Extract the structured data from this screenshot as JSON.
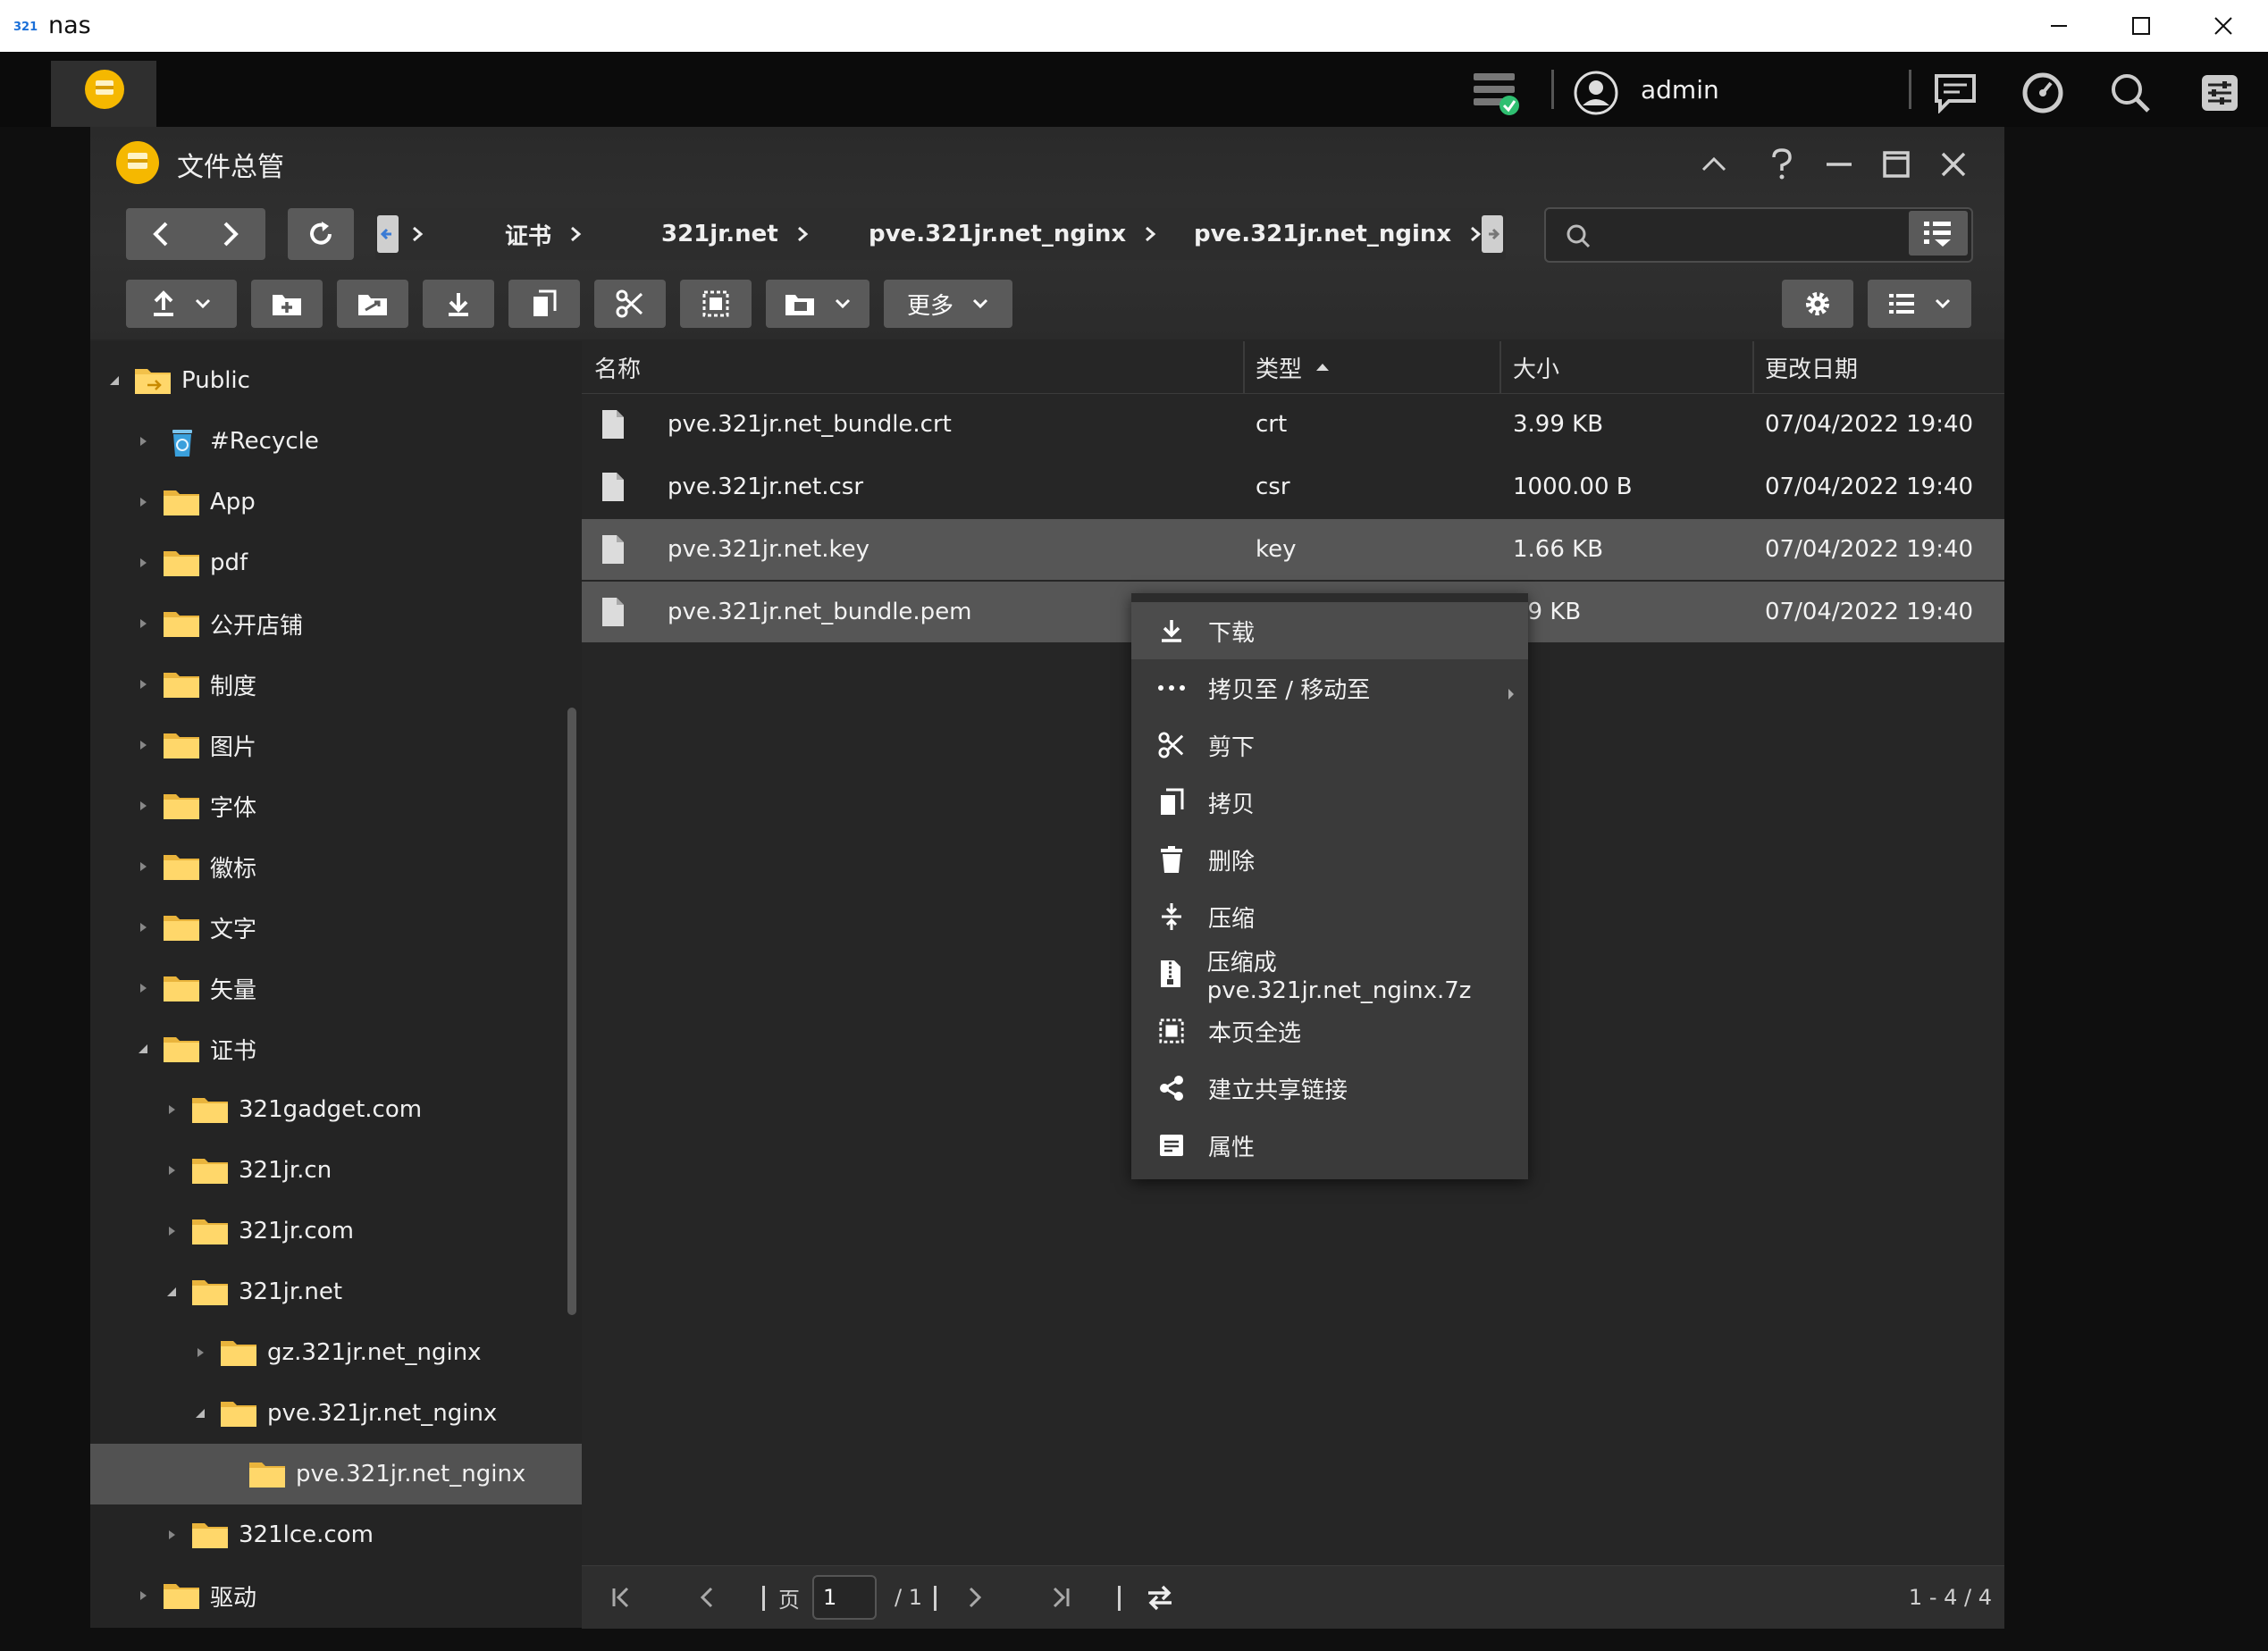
{
  "os_window": {
    "title": "nas"
  },
  "topbar": {
    "user": "admin"
  },
  "window": {
    "title": "文件总管"
  },
  "breadcrumb": [
    "证书",
    "321jr.net",
    "pve.321jr.net_nginx",
    "pve.321jr.net_nginx"
  ],
  "search": {
    "placeholder": ""
  },
  "toolbar": {
    "more_label": "更多"
  },
  "tree": [
    {
      "label": "Public",
      "level": 0,
      "state": "expanded",
      "icon": "public-folder-icon"
    },
    {
      "label": "#Recycle",
      "level": 1,
      "state": "collapsed",
      "icon": "recycle-bin-icon"
    },
    {
      "label": "App",
      "level": 1,
      "state": "collapsed",
      "icon": "folder-icon"
    },
    {
      "label": "pdf",
      "level": 1,
      "state": "collapsed",
      "icon": "folder-icon"
    },
    {
      "label": "公开店铺",
      "level": 1,
      "state": "collapsed",
      "icon": "folder-icon"
    },
    {
      "label": "制度",
      "level": 1,
      "state": "collapsed",
      "icon": "folder-icon"
    },
    {
      "label": "图片",
      "level": 1,
      "state": "collapsed",
      "icon": "folder-icon"
    },
    {
      "label": "字体",
      "level": 1,
      "state": "collapsed",
      "icon": "folder-icon"
    },
    {
      "label": "徽标",
      "level": 1,
      "state": "collapsed",
      "icon": "folder-icon"
    },
    {
      "label": "文字",
      "level": 1,
      "state": "collapsed",
      "icon": "folder-icon"
    },
    {
      "label": "矢量",
      "level": 1,
      "state": "collapsed",
      "icon": "folder-icon"
    },
    {
      "label": "证书",
      "level": 1,
      "state": "expanded",
      "icon": "folder-icon"
    },
    {
      "label": "321gadget.com",
      "level": 2,
      "state": "collapsed",
      "icon": "folder-icon"
    },
    {
      "label": "321jr.cn",
      "level": 2,
      "state": "collapsed",
      "icon": "folder-icon"
    },
    {
      "label": "321jr.com",
      "level": 2,
      "state": "collapsed",
      "icon": "folder-icon"
    },
    {
      "label": "321jr.net",
      "level": 2,
      "state": "expanded",
      "icon": "folder-icon"
    },
    {
      "label": "gz.321jr.net_nginx",
      "level": 3,
      "state": "collapsed",
      "icon": "folder-icon"
    },
    {
      "label": "pve.321jr.net_nginx",
      "level": 3,
      "state": "expanded",
      "icon": "folder-icon"
    },
    {
      "label": "pve.321jr.net_nginx",
      "level": 4,
      "state": "selected",
      "icon": "folder-icon"
    },
    {
      "label": "321lce.com",
      "level": 2,
      "state": "collapsed",
      "icon": "folder-icon"
    },
    {
      "label": "驱动",
      "level": 1,
      "state": "collapsed",
      "icon": "folder-icon"
    }
  ],
  "columns": {
    "name": "名称",
    "type": "类型",
    "size": "大小",
    "date": "更改日期"
  },
  "files": [
    {
      "name": "pve.321jr.net_bundle.crt",
      "type": "crt",
      "size": "3.99 KB",
      "date": "07/04/2022 19:40",
      "selected": false
    },
    {
      "name": "pve.321jr.net.csr",
      "type": "csr",
      "size": "1000.00 B",
      "date": "07/04/2022 19:40",
      "selected": false
    },
    {
      "name": "pve.321jr.net.key",
      "type": "key",
      "size": "1.66 KB",
      "date": "07/04/2022 19:40",
      "selected": true
    },
    {
      "name": "pve.321jr.net_bundle.pem",
      "type": "",
      "size": "99 KB",
      "date": "07/04/2022 19:40",
      "selected": true
    }
  ],
  "context_menu": [
    {
      "label": "下载",
      "icon": "download-icon"
    },
    {
      "label": "拷贝至 / 移动至",
      "icon": "more-dots-icon",
      "submenu": true
    },
    {
      "label": "剪下",
      "icon": "scissors-icon"
    },
    {
      "label": "拷贝",
      "icon": "copy-icon"
    },
    {
      "label": "删除",
      "icon": "trash-icon"
    },
    {
      "label": "压缩",
      "icon": "compress-icon"
    },
    {
      "label": "压缩成pve.321jr.net_nginx.7z",
      "icon": "archive-icon"
    },
    {
      "label": "本页全选",
      "icon": "select-all-icon"
    },
    {
      "label": "建立共享链接",
      "icon": "share-icon"
    },
    {
      "label": "属性",
      "icon": "properties-icon"
    }
  ],
  "pagination": {
    "page_label": "页",
    "page": "1",
    "total_pages": "/ 1",
    "range": "1 - 4 / 4"
  }
}
